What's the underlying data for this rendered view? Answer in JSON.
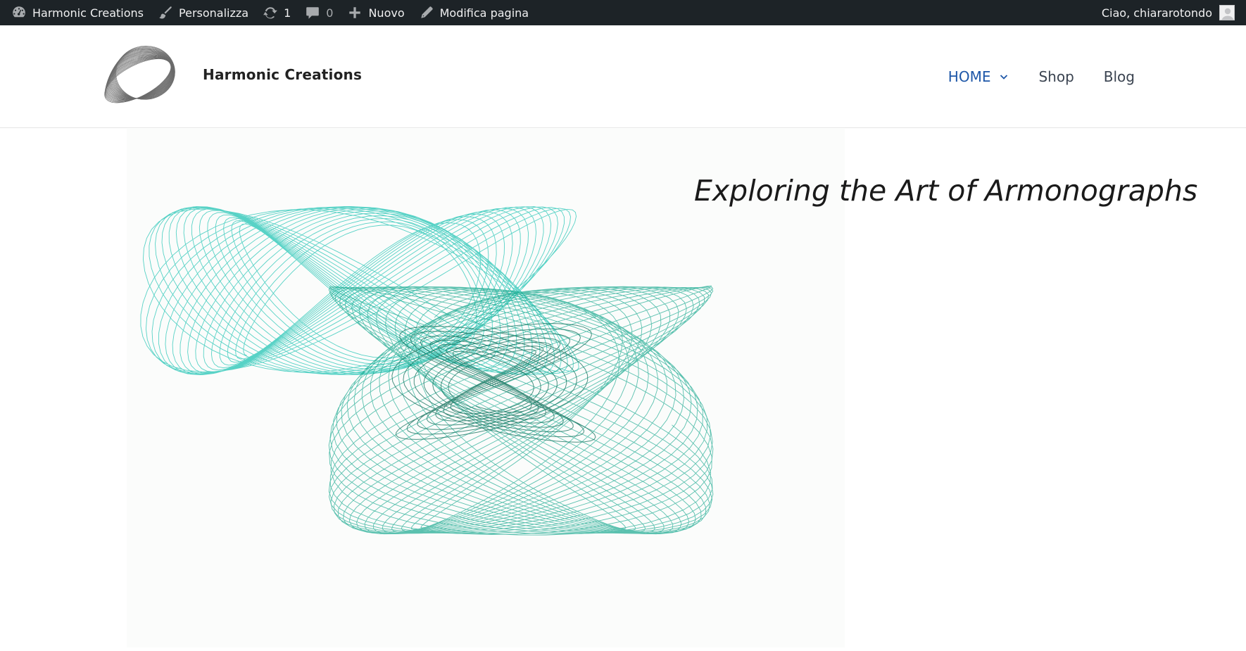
{
  "admin_bar": {
    "site_name": "Harmonic Creations",
    "customize_label": "Personalizza",
    "updates_count": "1",
    "comments_count": "0",
    "new_label": "Nuovo",
    "edit_page_label": "Modifica pagina",
    "greeting": "Ciao, chiararotondo",
    "icons": {
      "site": "dashboard-icon",
      "customize": "brush-icon",
      "updates": "refresh-icon",
      "comments": "comment-icon",
      "new": "plus-icon",
      "edit": "pencil-icon",
      "avatar": "user-avatar-icon"
    }
  },
  "header": {
    "site_title": "Harmonic Creations",
    "logo": "harmonograph-logo",
    "nav": [
      {
        "label": "HOME",
        "active": true,
        "has_dropdown": true
      },
      {
        "label": "Shop",
        "active": false,
        "has_dropdown": false
      },
      {
        "label": "Blog",
        "active": false,
        "has_dropdown": false
      }
    ]
  },
  "hero": {
    "title": "Exploring the Art of Armonographs",
    "image": "teal-harmonograph-drawing",
    "colors": {
      "teal_light": "#22c4b4",
      "teal_mid": "#17a88e",
      "teal_dark": "#0f6f5a"
    }
  },
  "colors": {
    "admin_bar_bg": "#1d2327",
    "nav_active": "#1e57a8",
    "nav_text": "#3a4350"
  }
}
